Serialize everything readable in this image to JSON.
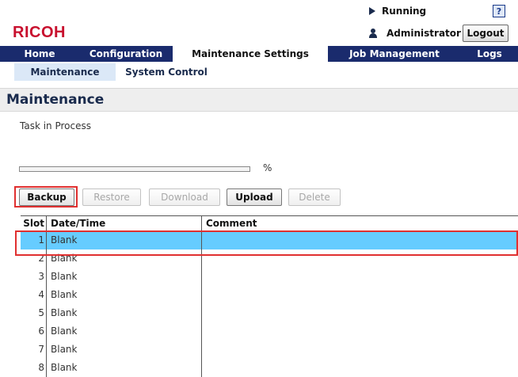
{
  "header": {
    "logo": "RICOH",
    "status": "Running",
    "help_label": "?",
    "user": "Administrator",
    "logout_label": "Logout"
  },
  "main_nav": {
    "tabs": [
      {
        "label": "Home",
        "active": false
      },
      {
        "label": "Configuration",
        "active": false
      },
      {
        "label": "Maintenance Settings",
        "active": true
      },
      {
        "label": "Job Management",
        "active": false
      },
      {
        "label": "Logs",
        "active": false
      }
    ]
  },
  "sub_nav": {
    "tabs": [
      {
        "label": "Maintenance",
        "active": true
      },
      {
        "label": "System Control",
        "active": false
      }
    ]
  },
  "page": {
    "title": "Maintenance",
    "task_text": "Task in Process",
    "progress_unit": "%",
    "progress_fraction": 0
  },
  "toolbar": {
    "backup": "Backup",
    "restore": "Restore",
    "download": "Download",
    "upload": "Upload",
    "delete": "Delete"
  },
  "table": {
    "columns": [
      "Slot",
      "Date/Time",
      "Comment"
    ],
    "selected_slot": 1,
    "rows": [
      {
        "slot": "1",
        "date": "Blank",
        "comment": ""
      },
      {
        "slot": "2",
        "date": "Blank",
        "comment": ""
      },
      {
        "slot": "3",
        "date": "Blank",
        "comment": ""
      },
      {
        "slot": "4",
        "date": "Blank",
        "comment": ""
      },
      {
        "slot": "5",
        "date": "Blank",
        "comment": ""
      },
      {
        "slot": "6",
        "date": "Blank",
        "comment": ""
      },
      {
        "slot": "7",
        "date": "Blank",
        "comment": ""
      },
      {
        "slot": "8",
        "date": "Blank",
        "comment": ""
      }
    ]
  },
  "colors": {
    "nav_bg": "#1a2b6d",
    "selected_row": "#66ccff",
    "highlight": "#e03030",
    "logo": "#c8102e"
  }
}
